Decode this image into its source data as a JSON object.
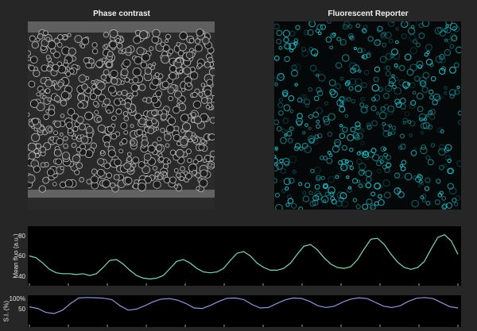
{
  "panels": {
    "phase_title": "Phase contrast",
    "fluo_title": "Fluorescent Reporter"
  },
  "colors": {
    "background": "#262626",
    "trace1": "#7fd6c0",
    "trace2": "#8f97d8",
    "fluo_cells": "#28c6d2"
  },
  "chart_data": [
    {
      "type": "line",
      "ylabel": "Mean fluo (a.u.)",
      "yticks": [
        "40",
        "60",
        "80"
      ],
      "ylim": [
        30,
        90
      ],
      "series": [
        {
          "values": [
            60,
            58,
            52,
            45,
            41,
            40,
            40,
            39,
            40,
            38,
            40,
            47,
            55,
            56,
            51,
            44,
            38,
            35,
            34,
            35,
            38,
            46,
            54,
            56,
            52,
            46,
            42,
            41,
            42,
            46,
            55,
            63,
            65,
            60,
            52,
            47,
            44,
            44,
            46,
            52,
            62,
            71,
            73,
            67,
            58,
            51,
            47,
            46,
            48,
            56,
            68,
            79,
            80,
            73,
            62,
            53,
            47,
            45,
            47,
            54,
            68,
            81,
            84,
            77,
            62
          ]
        }
      ]
    },
    {
      "type": "line",
      "ylabel": "S.I. (%)",
      "yticks": [
        "50",
        "100%"
      ],
      "ylim": [
        0,
        100
      ],
      "series": [
        {
          "values": [
            55,
            48,
            30,
            25,
            40,
            70,
            95,
            97,
            96,
            94,
            88,
            60,
            40,
            45,
            60,
            78,
            90,
            92,
            85,
            70,
            50,
            48,
            62,
            80,
            94,
            95,
            88,
            66,
            50,
            52,
            70,
            86,
            95,
            93,
            80,
            60,
            52,
            58,
            76,
            90,
            96,
            92,
            75,
            58,
            52,
            60,
            80,
            94,
            97,
            92,
            74,
            56,
            50
          ]
        }
      ]
    }
  ]
}
